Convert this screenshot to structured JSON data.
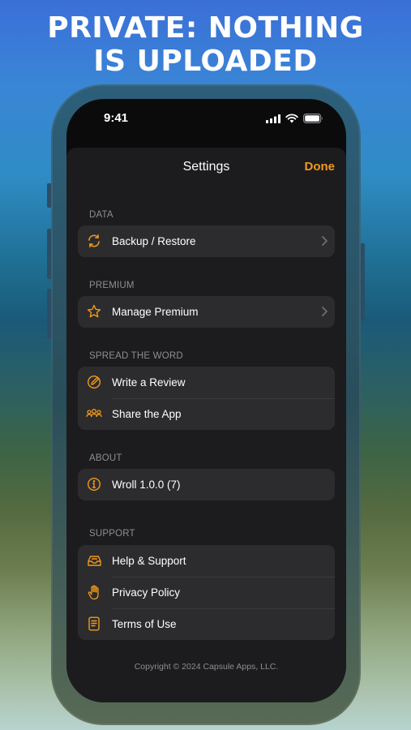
{
  "headline": {
    "line1": "PRIVATE: NOTHING",
    "line2": "IS UPLOADED"
  },
  "status_bar": {
    "time": "9:41"
  },
  "nav": {
    "title": "Settings",
    "done_label": "Done"
  },
  "colors": {
    "accent": "#f19a1a",
    "sheet_bg": "#1c1c1e",
    "cell_bg": "#2c2c2e",
    "header_text": "#8e8e93"
  },
  "sections": {
    "data": {
      "header": "DATA",
      "items": [
        {
          "label": "Backup / Restore",
          "icon": "sync-icon",
          "chevron": true
        }
      ]
    },
    "premium": {
      "header": "PREMIUM",
      "items": [
        {
          "label": "Manage Premium",
          "icon": "star-icon",
          "chevron": true
        }
      ]
    },
    "spread": {
      "header": "SPREAD THE WORD",
      "items": [
        {
          "label": "Write a Review",
          "icon": "compose-icon"
        },
        {
          "label": "Share the App",
          "icon": "people-icon"
        }
      ]
    },
    "about": {
      "header": "ABOUT",
      "items": [
        {
          "label": "Wroll 1.0.0 (7)",
          "icon": "info-icon"
        }
      ]
    },
    "support": {
      "header": "SUPPORT",
      "items": [
        {
          "label": "Help & Support",
          "icon": "tray-icon"
        },
        {
          "label": "Privacy Policy",
          "icon": "hand-icon"
        },
        {
          "label": "Terms of Use",
          "icon": "document-icon"
        }
      ]
    }
  },
  "footer": {
    "copyright": "Copyright © 2024 Capsule Apps, LLC."
  }
}
